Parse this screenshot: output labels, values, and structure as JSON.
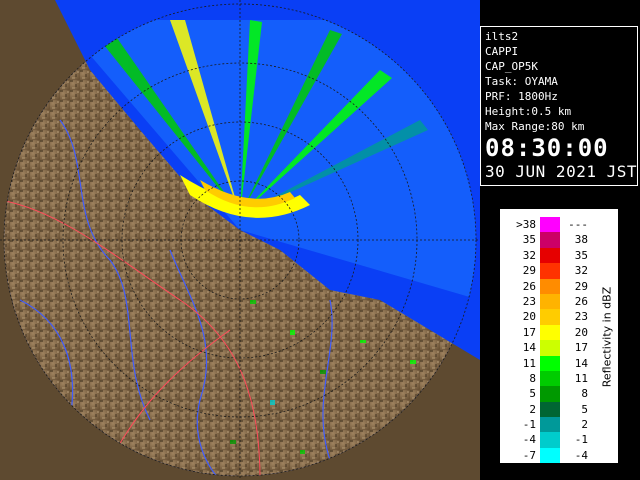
{
  "map": {
    "colors": {
      "background": "#000000",
      "sea": "#0a3ff5",
      "sea_echo": "#1e78ff",
      "land": "#7a5f3c",
      "land_shadow": "#3a2d1c",
      "rivers": "#3f5cff",
      "roads": "#ff4a5a",
      "range_rings": "#1a1a1a"
    }
  },
  "info": {
    "station": "ilts2",
    "product": "CAPPI",
    "product_code": "CAP_OP5K",
    "task": "Task: OYAMA",
    "prf": "PRF: 1800Hz",
    "height": "Height:0.5 km",
    "max_range": "Max Range:80 km",
    "time": "08:30:00",
    "date": "30 JUN 2021 JST"
  },
  "legend": {
    "title": "Reflectivity in dBZ",
    "rows": [
      {
        "lo": ">38",
        "hi": "---",
        "color": "#ff00ff"
      },
      {
        "lo": "35",
        "hi": "38",
        "color": "#cc0066"
      },
      {
        "lo": "32",
        "hi": "35",
        "color": "#e60000"
      },
      {
        "lo": "29",
        "hi": "32",
        "color": "#ff3300"
      },
      {
        "lo": "26",
        "hi": "29",
        "color": "#ff8c00"
      },
      {
        "lo": "23",
        "hi": "26",
        "color": "#ffb300"
      },
      {
        "lo": "20",
        "hi": "23",
        "color": "#ffcc00"
      },
      {
        "lo": "17",
        "hi": "20",
        "color": "#ffff00"
      },
      {
        "lo": "14",
        "hi": "17",
        "color": "#ccff00"
      },
      {
        "lo": "11",
        "hi": "14",
        "color": "#00ff00"
      },
      {
        "lo": "8",
        "hi": "11",
        "color": "#00cc00"
      },
      {
        "lo": "5",
        "hi": "8",
        "color": "#009900"
      },
      {
        "lo": "2",
        "hi": "5",
        "color": "#006633"
      },
      {
        "lo": "-1",
        "hi": "2",
        "color": "#009999"
      },
      {
        "lo": "-4",
        "hi": "-1",
        "color": "#00cccc"
      },
      {
        "lo": "-7",
        "hi": "-4",
        "color": "#00ffff"
      }
    ]
  }
}
